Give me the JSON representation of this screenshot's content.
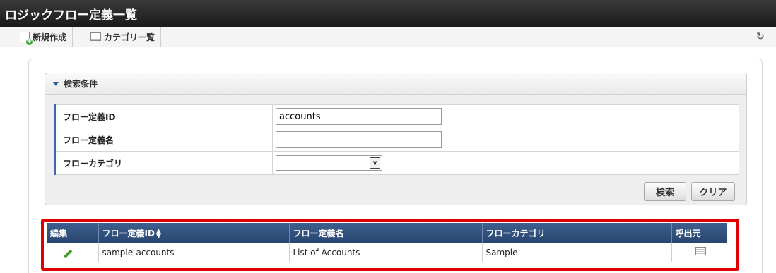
{
  "page": {
    "title": "ロジックフロー定義一覧"
  },
  "toolbar": {
    "new_label": "新規作成",
    "category_list_label": "カテゴリ一覧"
  },
  "search": {
    "header": "検索条件",
    "fields": [
      {
        "label": "フロー定義ID",
        "value": "accounts",
        "placeholder": ""
      },
      {
        "label": "フロー定義名",
        "value": "",
        "placeholder": ""
      },
      {
        "label": "フローカテゴリ",
        "value": ""
      }
    ],
    "search_button": "検索",
    "clear_button": "クリア"
  },
  "results": {
    "columns": [
      "編集",
      "フロー定義ID",
      "フロー定義名",
      "フローカテゴリ",
      "呼出元"
    ],
    "rows": [
      {
        "id": "sample-accounts",
        "name": "List of Accounts",
        "category": "Sample"
      }
    ]
  },
  "colors": {
    "title_bar": "#1f1f1f",
    "grid_header": "#33527f",
    "highlight_border": "#e00000",
    "label_accent": "#3f68a8"
  }
}
